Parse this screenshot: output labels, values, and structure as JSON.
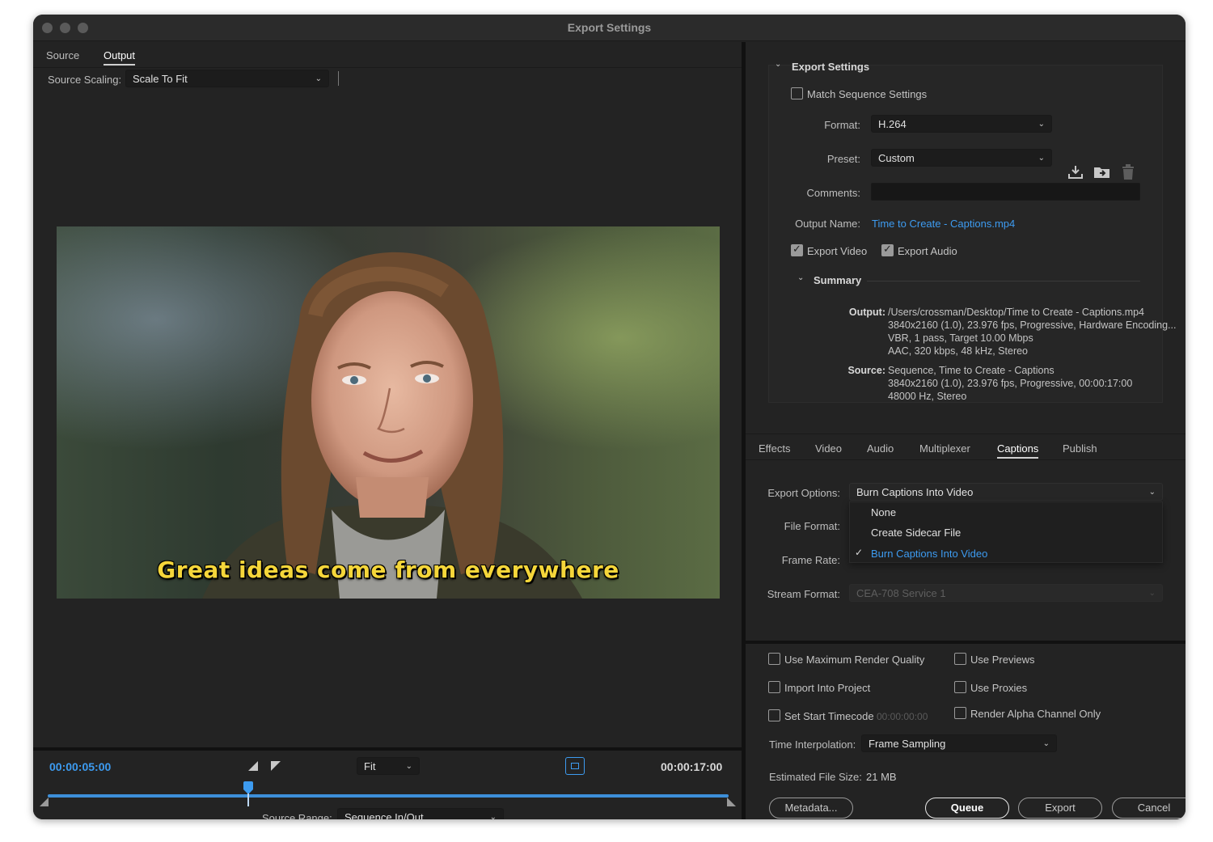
{
  "window": {
    "title": "Export Settings"
  },
  "left_panel": {
    "tabs": [
      {
        "label": "Source",
        "active": false
      },
      {
        "label": "Output",
        "active": true
      }
    ],
    "source_scaling": {
      "label": "Source Scaling:",
      "value": "Scale To Fit"
    },
    "preview": {
      "caption": "Great ideas come from everywhere"
    },
    "timeline": {
      "current_time": "00:00:05:00",
      "end_time": "00:00:17:00",
      "zoom": "Fit",
      "playhead_fraction": 0.294,
      "source_range": {
        "label": "Source Range:",
        "value": "Sequence In/Out"
      }
    }
  },
  "export_settings": {
    "section_title": "Export Settings",
    "match_sequence": {
      "label": "Match Sequence Settings",
      "checked": false
    },
    "format": {
      "label": "Format:",
      "value": "H.264"
    },
    "preset": {
      "label": "Preset:",
      "value": "Custom"
    },
    "comments": {
      "label": "Comments:",
      "value": ""
    },
    "output_name": {
      "label": "Output Name:",
      "value": "Time to Create - Captions.mp4"
    },
    "export_video": {
      "label": "Export Video",
      "checked": true
    },
    "export_audio": {
      "label": "Export Audio",
      "checked": true
    },
    "summary": {
      "title": "Summary",
      "output_key": "Output:",
      "output_lines": [
        "/Users/crossman/Desktop/Time to Create - Captions.mp4",
        "3840x2160 (1.0), 23.976 fps, Progressive, Hardware Encoding...",
        "VBR, 1 pass, Target 10.00 Mbps",
        "AAC, 320 kbps, 48 kHz, Stereo"
      ],
      "source_key": "Source:",
      "source_lines": [
        "Sequence, Time to Create - Captions",
        "3840x2160 (1.0), 23.976 fps, Progressive, 00:00:17:00",
        "48000 Hz, Stereo"
      ]
    }
  },
  "settings_tabs": [
    {
      "label": "Effects",
      "active": false
    },
    {
      "label": "Video",
      "active": false
    },
    {
      "label": "Audio",
      "active": false
    },
    {
      "label": "Multiplexer",
      "active": false
    },
    {
      "label": "Captions",
      "active": true
    },
    {
      "label": "Publish",
      "active": false
    }
  ],
  "captions": {
    "export_options": {
      "label": "Export Options:",
      "value": "Burn Captions Into Video"
    },
    "file_format": {
      "label": "File Format:"
    },
    "frame_rate": {
      "label": "Frame Rate:"
    },
    "stream_format": {
      "label": "Stream Format:",
      "value": "CEA-708 Service 1"
    },
    "menu_options": [
      {
        "label": "None",
        "selected": false
      },
      {
        "label": "Create Sidecar File",
        "selected": false
      },
      {
        "label": "Burn Captions Into Video",
        "selected": true
      }
    ]
  },
  "bottom_options": {
    "max_render_quality": {
      "label": "Use Maximum Render Quality",
      "checked": false
    },
    "use_previews": {
      "label": "Use Previews",
      "checked": false
    },
    "import_into_project": {
      "label": "Import Into Project",
      "checked": false
    },
    "use_proxies": {
      "label": "Use Proxies",
      "checked": false
    },
    "set_start_timecode": {
      "label": "Set Start Timecode",
      "value": "00:00:00:00",
      "checked": false
    },
    "render_alpha": {
      "label": "Render Alpha Channel Only",
      "checked": false
    },
    "time_interpolation": {
      "label": "Time Interpolation:",
      "value": "Frame Sampling"
    },
    "estimated_file_size": {
      "label": "Estimated File Size:",
      "value": "21 MB"
    }
  },
  "buttons": {
    "metadata": "Metadata...",
    "queue": "Queue",
    "export": "Export",
    "cancel": "Cancel"
  },
  "colors": {
    "accent_blue": "#3d9bf0",
    "caption_yellow": "#f5d63a",
    "panel_bg": "#232323"
  }
}
